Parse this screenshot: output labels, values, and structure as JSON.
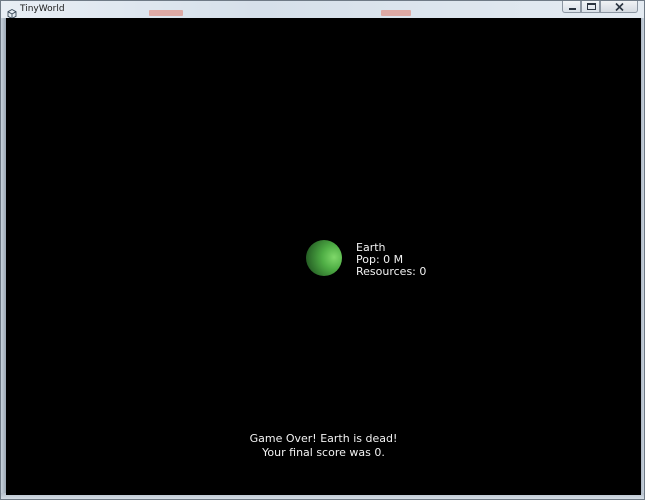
{
  "window": {
    "title": "TinyWorld",
    "controls": {
      "minimize_icon": "minimize-icon",
      "maximize_icon": "maximize-icon",
      "close_icon": "close-icon"
    }
  },
  "game": {
    "background_color": "#000000",
    "planet": {
      "name": "Earth",
      "population": "Pop: 0 M",
      "resources": "Resources: 0",
      "color": "#4fae45"
    },
    "message": {
      "line1": "Game Over! Earth is dead!",
      "line2": "Your final score was 0."
    }
  }
}
